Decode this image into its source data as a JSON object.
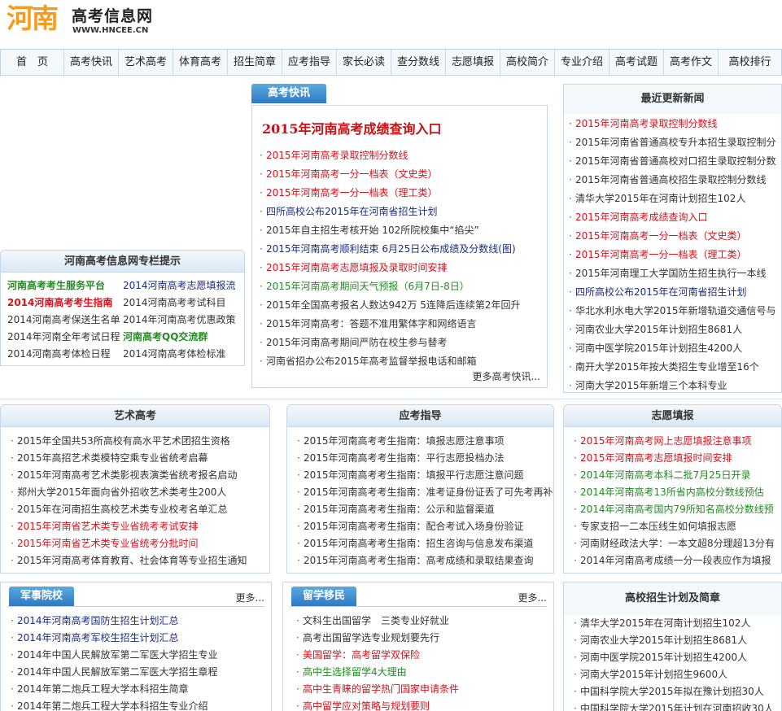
{
  "header": {
    "logo_text": "河南",
    "site_title": "高考信息网",
    "site_url": "WWW.HNCEE.CN"
  },
  "nav": {
    "items": [
      "首　页",
      "高考快讯",
      "艺术高考",
      "体育高考",
      "招生简章",
      "应考指导",
      "家长必读",
      "查分数线",
      "志愿填报",
      "高校简介",
      "专业介绍",
      "高考试题",
      "高考作文",
      "高校排行"
    ]
  },
  "column_tips": {
    "title": "河南高考信息网专栏提示",
    "items": [
      {
        "text": "河南高考考生服务平台",
        "color": "green",
        "bold": true
      },
      {
        "text": "2014河南高考志愿填报流",
        "color": "blue",
        "bold": false
      },
      {
        "text": "2014河南高考考生指南",
        "color": "red",
        "bold": true
      },
      {
        "text": "2014河南高考考试科目",
        "color": "gray",
        "bold": false
      },
      {
        "text": "2014河南高考保送生名单",
        "color": "gray",
        "bold": false
      },
      {
        "text": "2014年河南高考优惠政策",
        "color": "gray",
        "bold": false
      },
      {
        "text": "2014年河南全年考试日程",
        "color": "gray",
        "bold": false
      },
      {
        "text": "河南高考QQ交流群",
        "color": "green",
        "bold": true
      },
      {
        "text": "2014河南高考体检日程",
        "color": "gray",
        "bold": false
      },
      {
        "text": "2014河南高考体检标准",
        "color": "gray",
        "bold": false
      }
    ]
  },
  "news": {
    "tab_label": "高考快讯",
    "headline": "2015年河南高考成绩查询入口",
    "items": [
      {
        "text": "2015年河南高考录取控制分数线",
        "color": "red"
      },
      {
        "text": "2015年河南高考一分一档表（文史类）",
        "color": "red"
      },
      {
        "text": "2015年河南高考一分一档表（理工类）",
        "color": "red"
      },
      {
        "text": "四所高校公布2015年在河南省招生计划",
        "color": "blue"
      },
      {
        "text": "2015年自主招生考核开始  102所院校集中“掐尖”",
        "color": "gray"
      },
      {
        "text": "2015年河南高考顺利结束  6月25日公布成绩及分数线(图)",
        "color": "blue"
      },
      {
        "text": "2015年河南高考志愿填报及录取时间安排",
        "color": "red"
      },
      {
        "text": "  2015年河南高考期间天气预报（6月7日-8日）",
        "color": "green"
      },
      {
        "text": "2015年全国高考报名人数达942万  5连降后连续第2年回升",
        "color": "gray"
      },
      {
        "text": "2015年河南高考：答题不准用繁体字和网络语言",
        "color": "gray"
      },
      {
        "text": "2015年河南高考期间严防在校生参与替考",
        "color": "gray"
      },
      {
        "text": "河南省招办公布2015年高考监督举报电话和邮箱",
        "color": "gray"
      }
    ],
    "more": "更多高考快讯..."
  },
  "latest": {
    "title": "最近更新新闻",
    "items": [
      {
        "text": "2015年河南高考录取控制分数线",
        "color": "red"
      },
      {
        "text": "2015年河南省普通高校专升本招生录取控制分",
        "color": "gray"
      },
      {
        "text": "2015年河南省普通高校对口招生录取控制分数",
        "color": "gray"
      },
      {
        "text": "2015年河南省普通高校招生录取控制分数线",
        "color": "gray"
      },
      {
        "text": "清华大学2015年在河南计划招生102人",
        "color": "gray"
      },
      {
        "text": "2015年河南高考成绩查询入口",
        "color": "red"
      },
      {
        "text": "2015年河南高考一分一档表（文史类）",
        "color": "red"
      },
      {
        "text": "2015年河南高考一分一档表（理工类）",
        "color": "red"
      },
      {
        "text": "2015年河南理工大学国防生招生执行一本线",
        "color": "gray"
      },
      {
        "text": "四所高校公布2015年在河南省招生计划",
        "color": "blue"
      },
      {
        "text": "华北水利水电大学2015年新增轨道交通信号与",
        "color": "gray"
      },
      {
        "text": "河南农业大学2015年计划招生8681人",
        "color": "gray"
      },
      {
        "text": "河南中医学院2015年计划招生4200人",
        "color": "gray"
      },
      {
        "text": "南开大学2015年按大类招生专业增至16个",
        "color": "gray"
      },
      {
        "text": "河南大学2015年新增三个本科专业",
        "color": "gray"
      }
    ]
  },
  "art": {
    "title": "艺术高考",
    "items": [
      {
        "text": "2015年全国共53所高校有高水平艺术团招生资格",
        "color": "gray"
      },
      {
        "text": "2015年高招艺术类模特空乘专业省统考启幕",
        "color": "gray"
      },
      {
        "text": "2015年河南高考艺术类影视表演类省统考报名启动",
        "color": "gray"
      },
      {
        "text": "郑州大学2015年面向省外招收艺术类考生200人",
        "color": "gray"
      },
      {
        "text": "2015年在河南招生高校艺术类专业校考名单汇总",
        "color": "gray"
      },
      {
        "text": "2015年河南省艺术类专业省统考考试安排",
        "color": "red"
      },
      {
        "text": "2015年河南省艺术类专业省统考分批时间",
        "color": "red"
      },
      {
        "text": "2015年河南高考体育教育、社会体育等专业招生通知",
        "color": "gray"
      }
    ]
  },
  "guide": {
    "title": "应考指导",
    "items": [
      {
        "text": "2015年河南高考考生指南：填报志愿注意事项",
        "color": "gray"
      },
      {
        "text": "2015年河南高考考生指南：平行志愿投档办法",
        "color": "gray"
      },
      {
        "text": "2015年河南高考考生指南：填报平行志愿注意问题",
        "color": "gray"
      },
      {
        "text": "2015年河南高考考生指南：准考证身份证丢了可先考再补",
        "color": "gray"
      },
      {
        "text": "2015年河南高考考生指南：公示和监督渠道",
        "color": "gray"
      },
      {
        "text": "2015年河南高考考生指南：配合考试入场身份验证",
        "color": "gray"
      },
      {
        "text": "2015年河南高考考生指南：招生咨询与信息发布渠道",
        "color": "gray"
      },
      {
        "text": "2015年河南高考考生指南：高考成绩和录取结果查询",
        "color": "gray"
      }
    ]
  },
  "volunteer": {
    "title": "志愿填报",
    "items": [
      {
        "text": "2015年河南高考网上志愿填报注意事项",
        "color": "red"
      },
      {
        "text": "2015年河南高考志愿填报时间安排",
        "color": "red"
      },
      {
        "text": "2014年河南高考本科二批7月25日开录",
        "color": "green"
      },
      {
        "text": "2014年河南高考13所省内高校分数线预估",
        "color": "green"
      },
      {
        "text": "2014年河南高考国内79所知名高校分数线预",
        "color": "green"
      },
      {
        "text": "专家支招一二本压线生如何填报志愿",
        "color": "gray"
      },
      {
        "text": "河南财经政法大学：一本文超8分理超13分有",
        "color": "gray"
      },
      {
        "text": "2014年河南高考成绩一分一段表应作为填报",
        "color": "gray"
      }
    ]
  },
  "military": {
    "tab_label": "军事院校",
    "more": "更多...",
    "items": [
      {
        "text": "2014年河南高考国防生招生计划汇总",
        "color": "blue"
      },
      {
        "text": "2014年河南高考军校生招生计划汇总",
        "color": "blue"
      },
      {
        "text": "2014年中国人民解放军第二军医大学招生专业",
        "color": "gray"
      },
      {
        "text": "2014年中国人民解放军第二军医大学招生章程",
        "color": "gray"
      },
      {
        "text": "2014年第二炮兵工程大学本科招生简章",
        "color": "gray"
      },
      {
        "text": "2014年第二炮兵工程大学本科招生专业介绍",
        "color": "gray"
      }
    ]
  },
  "study_abroad": {
    "tab_label": "留学移民",
    "more": "更多...",
    "items": [
      {
        "text": "文科生出国留学　三类专业好就业",
        "color": "gray"
      },
      {
        "text": "高考出国留学选专业规划要先行",
        "color": "gray"
      },
      {
        "text": "美国留学：高考留学双保险",
        "color": "red"
      },
      {
        "text": "高中生选择留学4大理由",
        "color": "green"
      },
      {
        "text": "高中生青睐的留学热门国家申请条件",
        "color": "red"
      },
      {
        "text": "高中留学应对策略与规划要则",
        "color": "red"
      }
    ]
  },
  "plans": {
    "title": "高校招生计划及简章",
    "items": [
      {
        "text": "清华大学2015年在河南计划招生102人",
        "color": "gray"
      },
      {
        "text": "河南农业大学2015年计划招生8681人",
        "color": "gray"
      },
      {
        "text": "河南中医学院2015年计划招生4200人",
        "color": "gray"
      },
      {
        "text": "河南大学2015年计划招生9600人",
        "color": "gray"
      },
      {
        "text": "中国科学院大学2015年拟在豫计划招30人",
        "color": "gray"
      },
      {
        "text": "中国科学院大学2015年计划在河南招收30人",
        "color": "gray"
      }
    ]
  }
}
